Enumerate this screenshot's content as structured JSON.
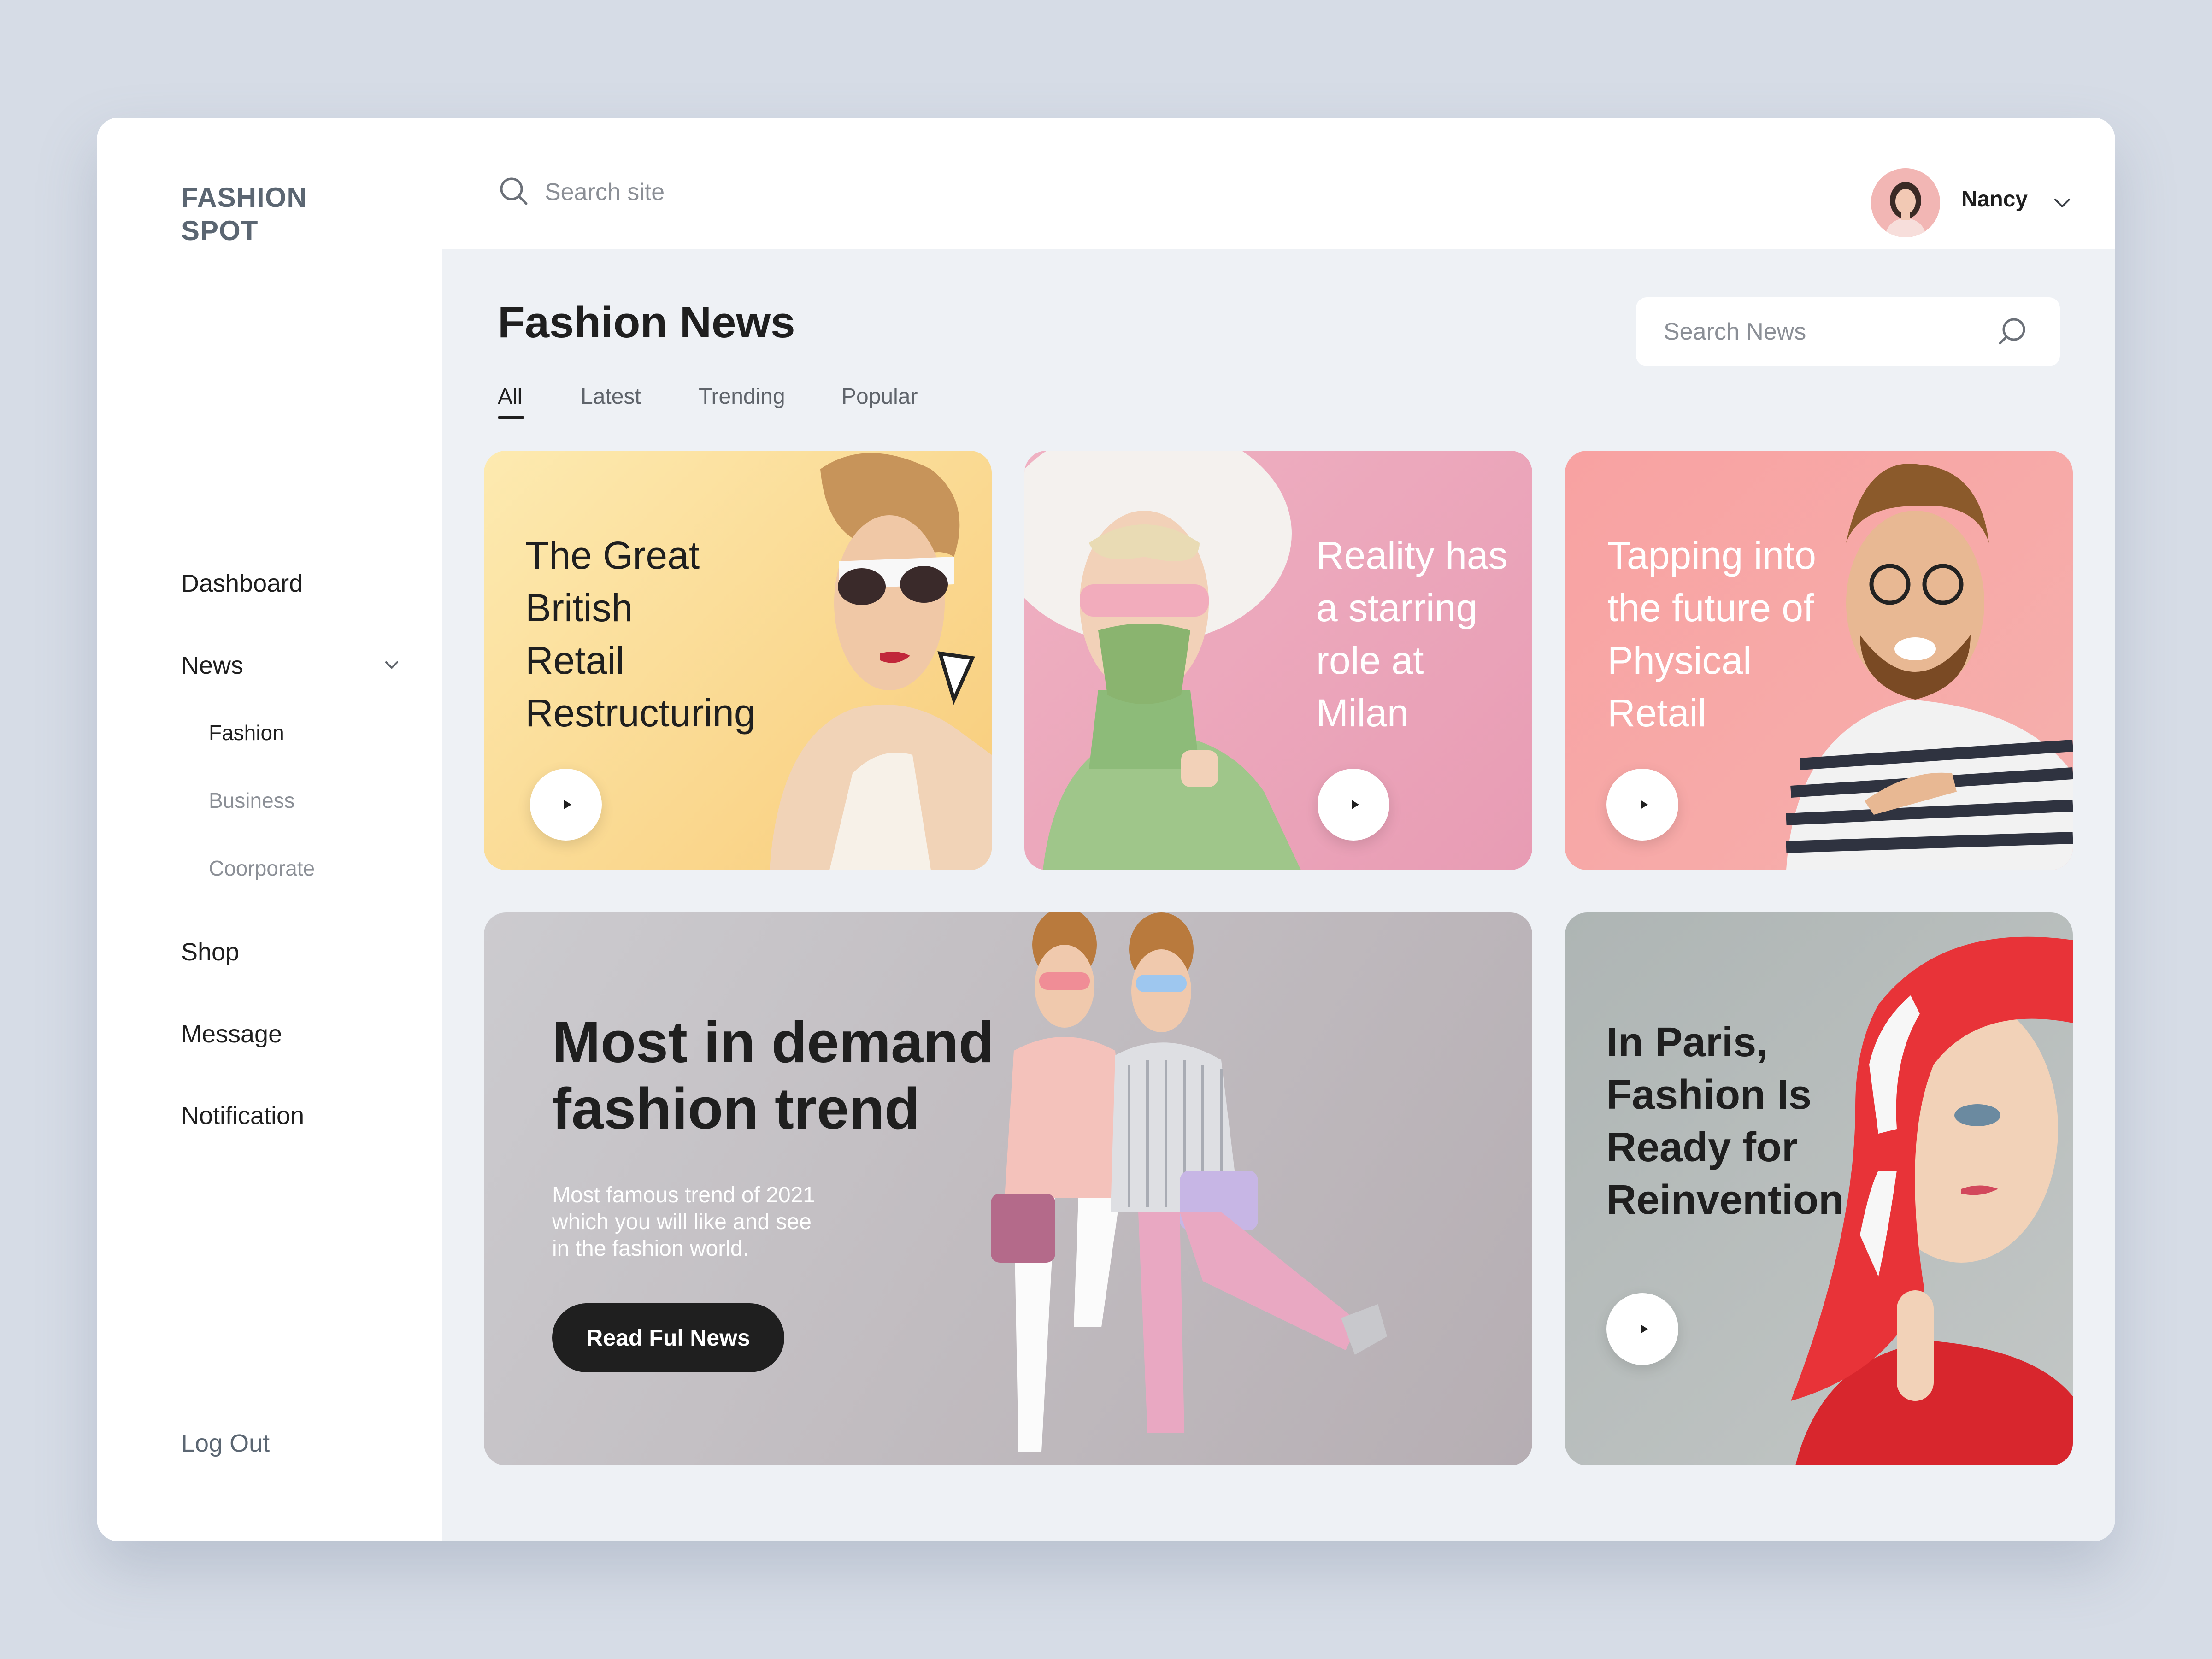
{
  "app": {
    "logo": "FASHION SPOT"
  },
  "sidebar": {
    "items": [
      {
        "label": "Dashboard"
      },
      {
        "label": "News"
      },
      {
        "label": "Shop"
      },
      {
        "label": "Message"
      },
      {
        "label": "Notification"
      }
    ],
    "news_sub": [
      {
        "label": "Fashion"
      },
      {
        "label": "Business"
      },
      {
        "label": "Coorporate"
      }
    ],
    "logout": "Log Out"
  },
  "topbar": {
    "search_placeholder": "Search site",
    "user_name": "Nancy"
  },
  "main": {
    "title": "Fashion News",
    "tabs": [
      {
        "label": "All"
      },
      {
        "label": "Latest"
      },
      {
        "label": "Trending"
      },
      {
        "label": "Popular"
      }
    ],
    "active_tab": "All",
    "news_search_placeholder": "Search News"
  },
  "cards": [
    {
      "title": "The Great British Retail Restructuring",
      "lines": [
        "The Great",
        "British",
        "Retail",
        "Restructuring"
      ],
      "text_color": "#1f1f1f"
    },
    {
      "title": "Reality has a starring role at Milan",
      "lines": [
        "Reality has",
        "a starring",
        "role at",
        "Milan"
      ],
      "text_color": "#ffffff"
    },
    {
      "title": "Tapping into the future of Physical Retail",
      "lines": [
        "Tapping into",
        "the future of",
        "Physical",
        "Retail"
      ],
      "text_color": "#ffffff"
    }
  ],
  "hero": {
    "title_lines": [
      "Most in demand",
      "fashion trend"
    ],
    "desc_lines": [
      "Most famous trend of 2021",
      "which you will like and see",
      "in the fashion world."
    ],
    "button": "Read Ful News"
  },
  "card_paris": {
    "lines": [
      "In Paris,",
      "Fashion Is",
      "Ready for",
      "Reinvention"
    ]
  },
  "colors": {
    "accent_dark": "#1f1f1f",
    "card_yellow": "#fbe3a4",
    "card_pink": "#eba8bd",
    "card_salmon": "#f7a6a5",
    "card_grey": "#c3bfc3"
  }
}
